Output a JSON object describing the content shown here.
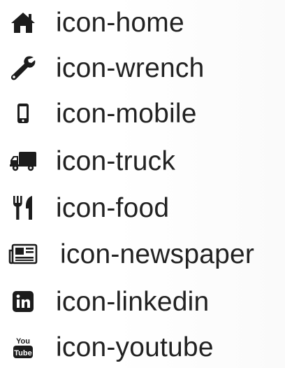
{
  "colors": {
    "icon": "#1c1c1c",
    "text": "#222222",
    "background": "#ffffff"
  },
  "icons": [
    {
      "icon": "home-icon",
      "label": "icon-home"
    },
    {
      "icon": "wrench-icon",
      "label": "icon-wrench"
    },
    {
      "icon": "mobile-icon",
      "label": "icon-mobile"
    },
    {
      "icon": "truck-icon",
      "label": "icon-truck"
    },
    {
      "icon": "food-icon",
      "label": "icon-food"
    },
    {
      "icon": "newspaper-icon",
      "label": "icon-newspaper"
    },
    {
      "icon": "linkedin-icon",
      "label": "icon-linkedin"
    },
    {
      "icon": "youtube-icon",
      "label": "icon-youtube"
    }
  ]
}
